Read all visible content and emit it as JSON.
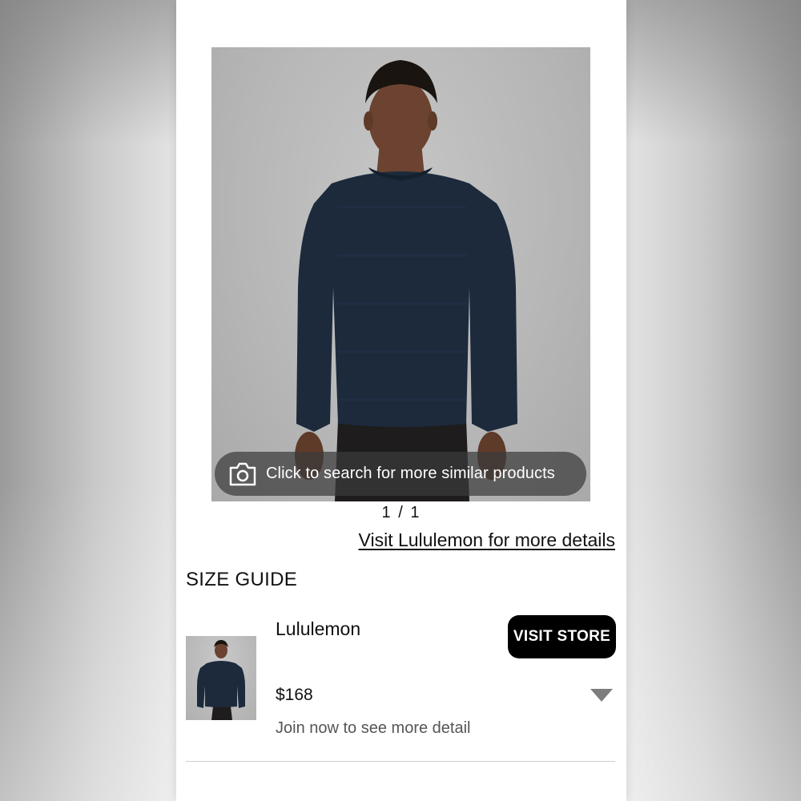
{
  "product": {
    "image_alt": "Man wearing navy crewneck sweater",
    "visual_search_label": "Click to search for more similar products",
    "visual_search_icon": "camera-icon",
    "pager": "1 / 1",
    "visit_link": "Visit Lululemon for more details"
  },
  "size_guide": {
    "label": "SIZE GUIDE"
  },
  "offer": {
    "brand": "Lululemon",
    "visit_store_label": "VISIT STORE",
    "price": "$168",
    "expand_icon": "caret-down-icon",
    "join_text": "Join now to see more detail"
  },
  "colors": {
    "sweater": "#1c2a3c",
    "button": "#000000",
    "overlay": "#3c3c3c"
  }
}
